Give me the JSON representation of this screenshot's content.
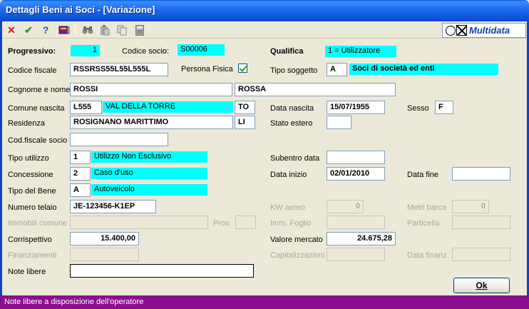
{
  "window": {
    "title": "Dettagli Beni ai Soci - [Variazione]"
  },
  "toolbar": {
    "brand": "Multidata"
  },
  "labels": {
    "progressivo": "Progressivo:",
    "codice_socio": "Codice socio:",
    "qualifica": "Qualifica",
    "codice_fiscale": "Codice fiscale",
    "persona_fisica": "Persona Fisica",
    "tipo_soggetto": "Tipo soggetto",
    "cognome_nome": "Cognome e nome",
    "comune_nascita": "Comune nascita",
    "data_nascita": "Data nascita",
    "sesso": "Sesso",
    "residenza": "Residenza",
    "stato_estero": "Stato estero",
    "cod_fiscale_socio": "Cod.fiscale socio",
    "tipo_utilizzo": "Tipo utilizzo",
    "subentro_data": "Subentro data",
    "concessione": "Concessione",
    "data_inizio": "Data inizio",
    "data_fine": "Data fine",
    "tipo_bene": "Tipo del Bene",
    "numero_telaio": "Numero telaio",
    "kw_aereo": "KW aereo",
    "metri_barca": "Metri barca",
    "immobili_comune": "Immobili comune",
    "prov": "Prov.",
    "imm_foglio": "Imm. Foglio",
    "particella": "Particella",
    "corrispettivo": "Corrispettivo",
    "valore_mercato": "Valore mercato",
    "finanziamenti": "Finanziamenti",
    "capitalizzazioni": "Capitalizzazioni",
    "data_finanz": "Data finanz.",
    "note_libere": "Note libere"
  },
  "values": {
    "progressivo": "1",
    "codice_socio": "S00006",
    "qualifica": "1 = Utilizzatore",
    "codice_fiscale": "RSSRSS55L55L555L",
    "persona_fisica": true,
    "tipo_soggetto_code": "A",
    "tipo_soggetto_desc": "Soci di società ed enti",
    "cognome": "ROSSI",
    "nome": "ROSSA",
    "comune_nascita_code": "L555",
    "comune_nascita_desc": "VAL DELLA TORRE",
    "comune_nascita_prov": "TO",
    "data_nascita": "15/07/1955",
    "sesso": "F",
    "residenza": "ROSIGNANO MARITTIMO",
    "residenza_prov": "LI",
    "stato_estero": "",
    "cod_fiscale_socio": "",
    "tipo_utilizzo_code": "1",
    "tipo_utilizzo_desc": "Utilizzo Non Esclusivo",
    "subentro_data": "",
    "concessione_code": "2",
    "concessione_desc": "Caso d'uso",
    "data_inizio": "02/01/2010",
    "data_fine": "",
    "tipo_bene_code": "A",
    "tipo_bene_desc": "Autoveicolo",
    "numero_telaio": "JE-123456-K1EP",
    "kw_aereo": "0",
    "metri_barca": "0",
    "immobili_comune": "",
    "prov": "",
    "imm_foglio": "",
    "particella": "",
    "corrispettivo": "15.400,00",
    "valore_mercato": "24.675,28",
    "finanziamenti": "",
    "capitalizzazioni": "",
    "data_finanz": "",
    "note_libere": ""
  },
  "buttons": {
    "ok": "Ok"
  },
  "status": {
    "text": "Note libere a disposizione dell'operatore"
  }
}
